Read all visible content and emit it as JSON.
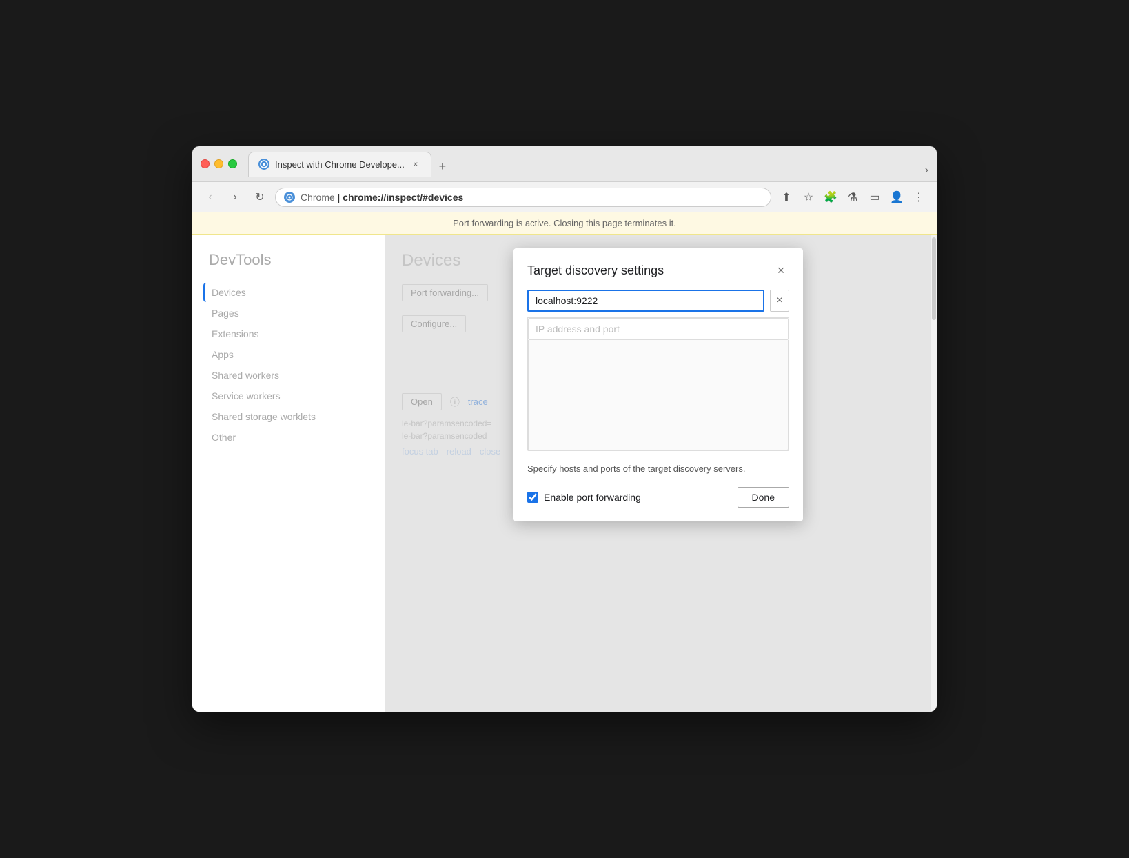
{
  "browser": {
    "tab_title": "Inspect with Chrome Develope...",
    "url_site": "Chrome",
    "url_path": "chrome://inspect/#devices",
    "new_tab_label": "+",
    "tab_chevron": "›"
  },
  "banner": {
    "text": "Port forwarding is active. Closing this page terminates it."
  },
  "sidebar": {
    "title": "DevTools",
    "items": [
      {
        "label": "Devices",
        "active": true
      },
      {
        "label": "Pages"
      },
      {
        "label": "Extensions"
      },
      {
        "label": "Apps"
      },
      {
        "label": "Shared workers"
      },
      {
        "label": "Service workers"
      },
      {
        "label": "Shared storage worklets"
      },
      {
        "label": "Other"
      }
    ]
  },
  "page": {
    "title": "Devices"
  },
  "bg_buttons": {
    "forwarding": "Port forwarding...",
    "configure": "Configure...",
    "open": "Open",
    "trace": "trace"
  },
  "modal": {
    "title": "Target discovery settings",
    "close_icon": "×",
    "host_value": "localhost:9222",
    "placeholder": "IP address and port",
    "clear_icon": "×",
    "description": "Specify hosts and ports of the target discovery servers.",
    "checkbox_label": "Enable port forwarding",
    "done_label": "Done"
  },
  "action_links": {
    "focus_tab": "focus tab",
    "reload": "reload",
    "close": "close"
  }
}
